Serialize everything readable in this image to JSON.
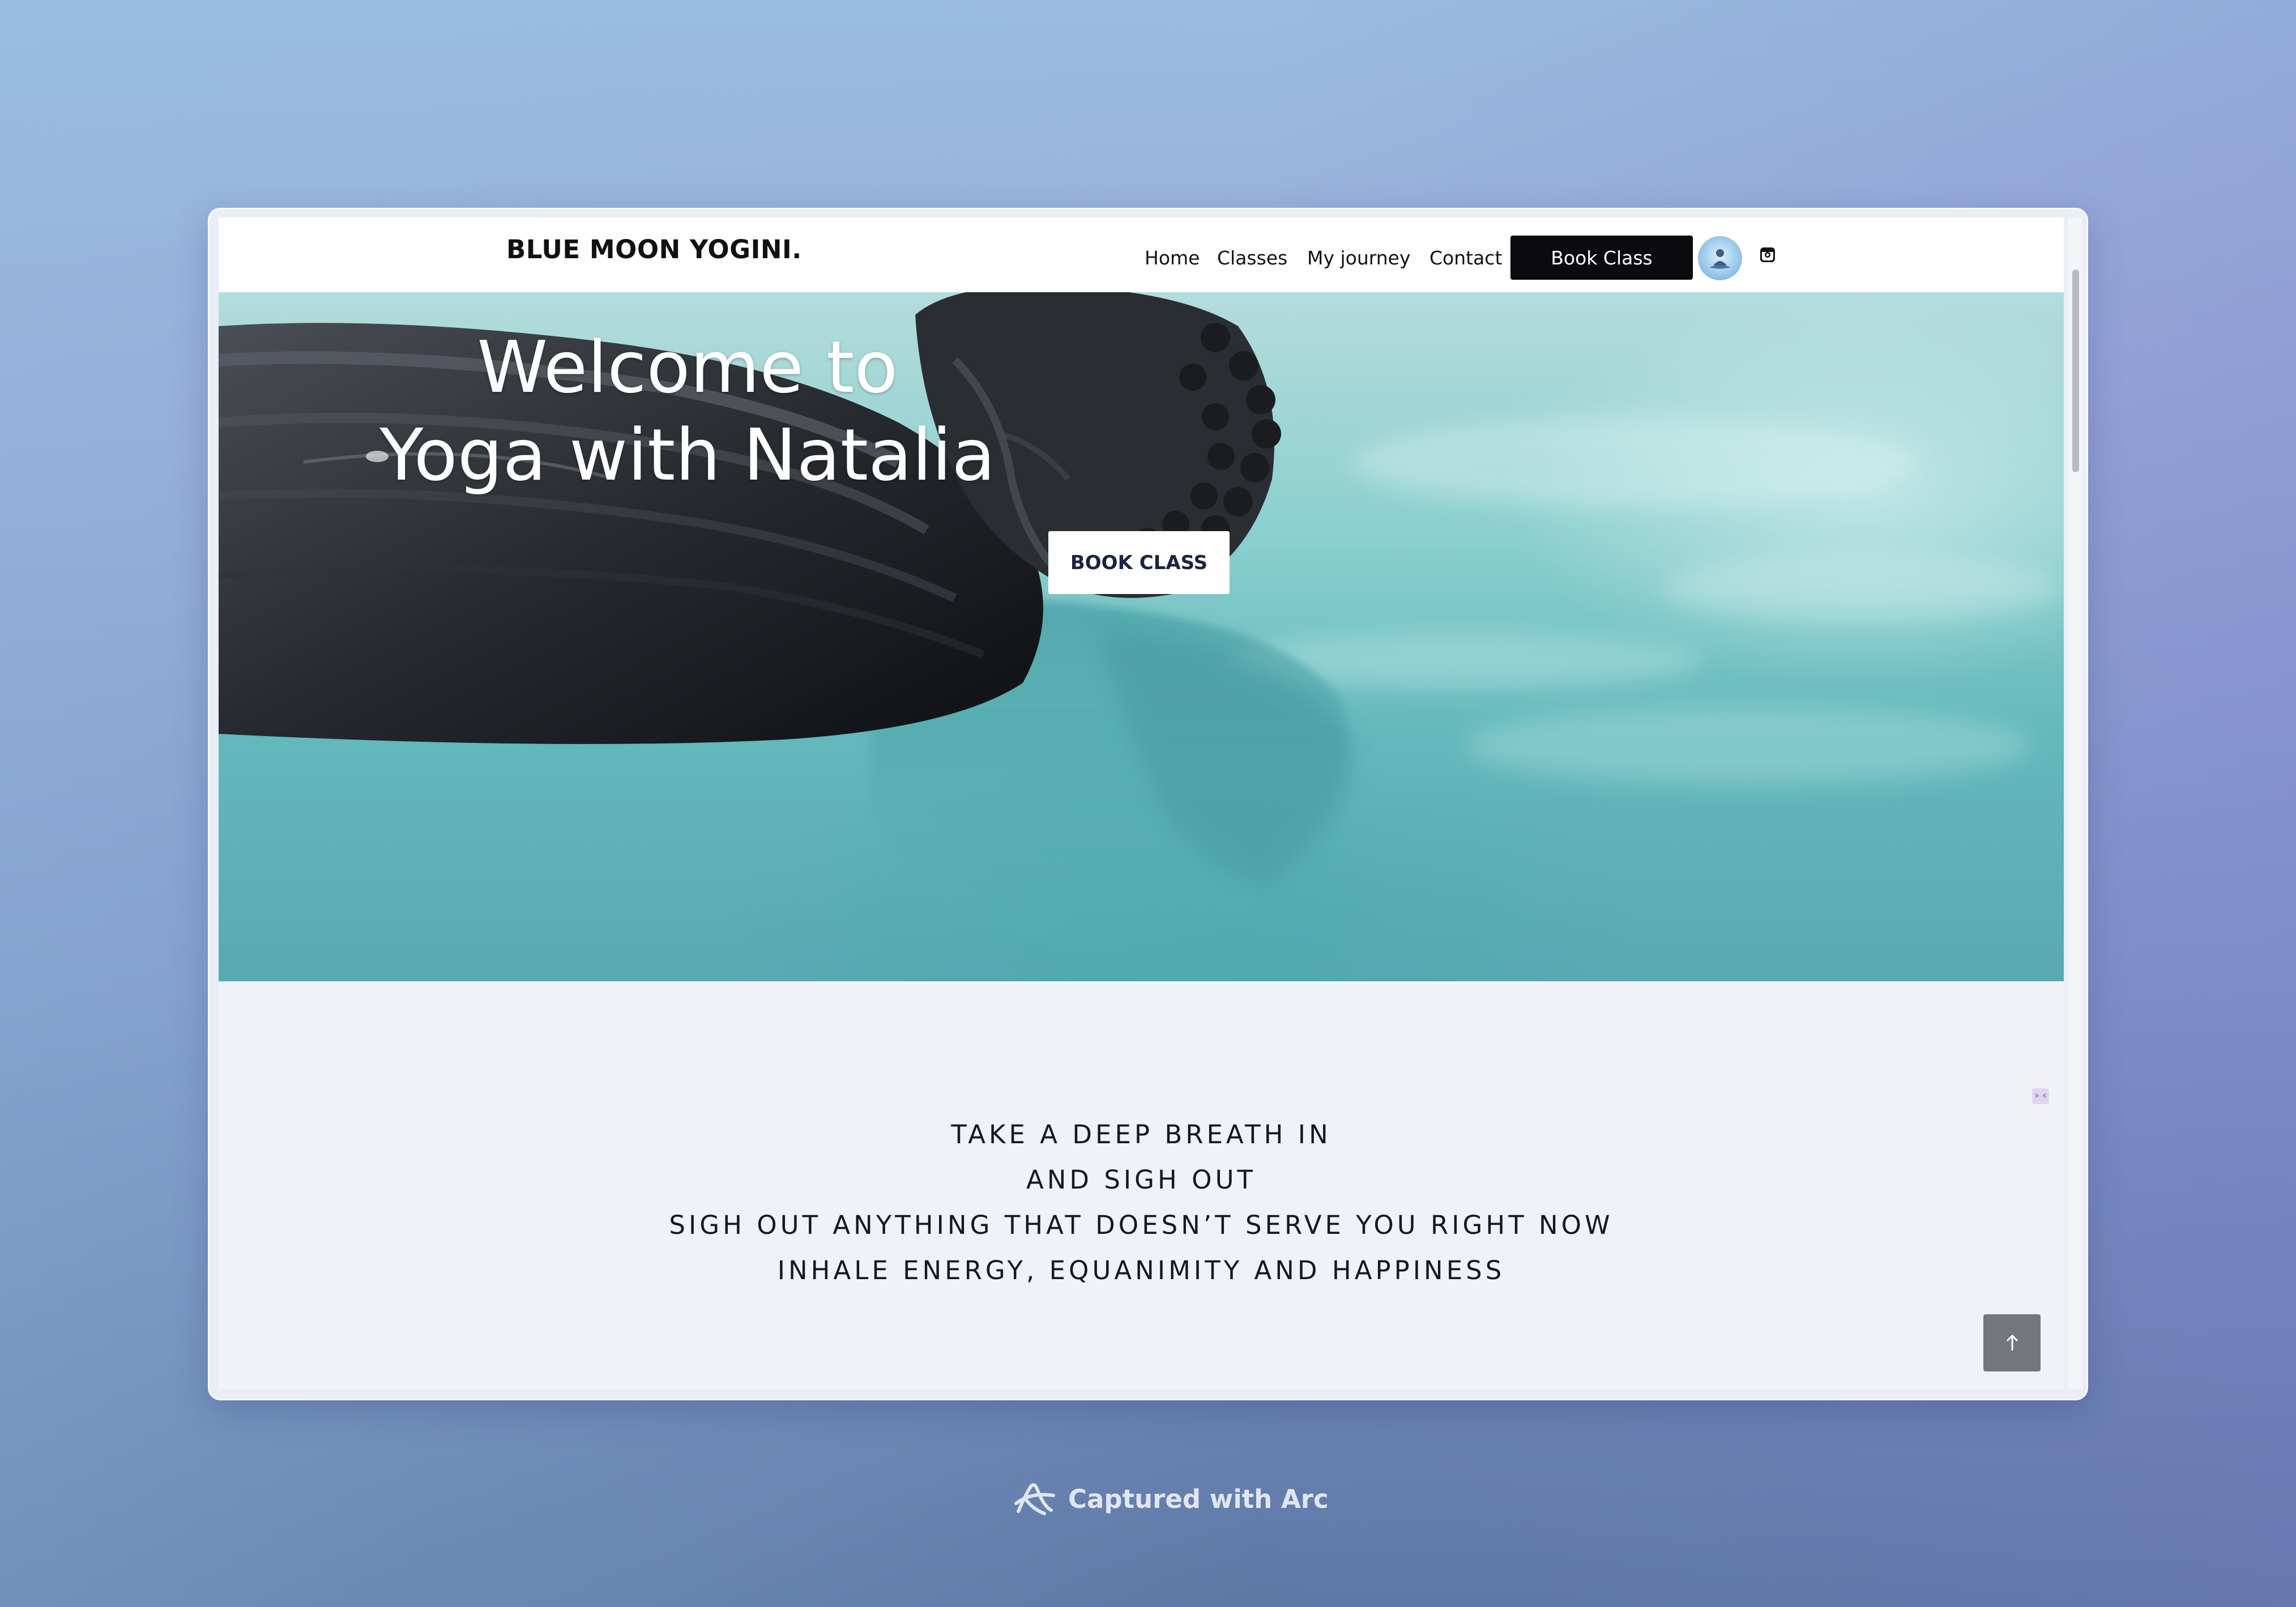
{
  "site": {
    "brand": "BLUE MOON YOGINI.",
    "nav": [
      {
        "label": "Home"
      },
      {
        "label": "Classes"
      },
      {
        "label": "My journey"
      },
      {
        "label": "Contact"
      }
    ],
    "book_label": "Book Class",
    "avatar_icon": "meditation-avatar-icon",
    "social_icon": "instagram-icon"
  },
  "hero": {
    "title_line1": "Welcome to",
    "title_line2": "Yoga with Natalia",
    "button_label": "BOOK CLASS"
  },
  "quote": {
    "lines": [
      "TAKE A DEEP BREATH IN",
      "AND SIGH OUT",
      "SIGH OUT ANYTHING THAT DOESN’T SERVE YOU RIGHT NOW",
      "INHALE ENERGY, EQUANIMITY AND HAPPINESS"
    ]
  },
  "widgets": {
    "scroll_top_icon": "arrow-up-icon",
    "chat_icon": "chat-widget-icon"
  },
  "caption": {
    "text": "Captured with Arc",
    "icon": "arc-logo-icon"
  },
  "colors": {
    "nav_button_bg": "#0a0a0f",
    "hero_water": "#62b8bb",
    "page_bg": "#eff3f8",
    "scroll_top_bg": "#74777d"
  }
}
